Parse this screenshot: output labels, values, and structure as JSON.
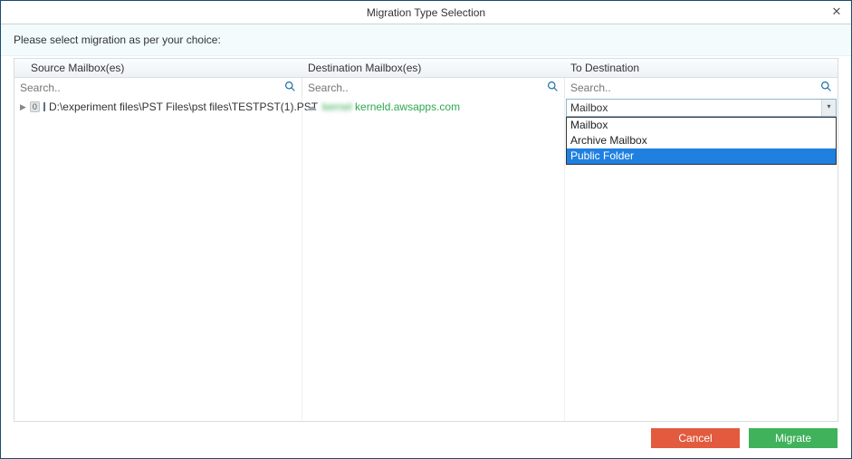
{
  "titlebar": {
    "title": "Migration Type Selection",
    "close_glyph": "✕"
  },
  "prompt": "Please select migration as per your choice:",
  "columns": {
    "source_header": "Source Mailbox(es)",
    "dest_header": "Destination Mailbox(es)",
    "todest_header": "To Destination"
  },
  "search": {
    "placeholder": "Search.."
  },
  "source_tree": {
    "expand_glyph": "▶",
    "badge": "0",
    "path_text": "D:\\experiment files\\PST Files\\pst files\\TESTPST(1).PST"
  },
  "destination_item": {
    "cloud_glyph": "☁",
    "blurred_prefix": "kernel   ",
    "visible_suffix": "kerneld.awsapps.com"
  },
  "to_destination": {
    "selected": "Mailbox",
    "chevron": "▾",
    "options": {
      "0": "Mailbox",
      "1": "Archive Mailbox",
      "2": "Public Folder"
    }
  },
  "footer": {
    "cancel": "Cancel",
    "migrate": "Migrate"
  }
}
